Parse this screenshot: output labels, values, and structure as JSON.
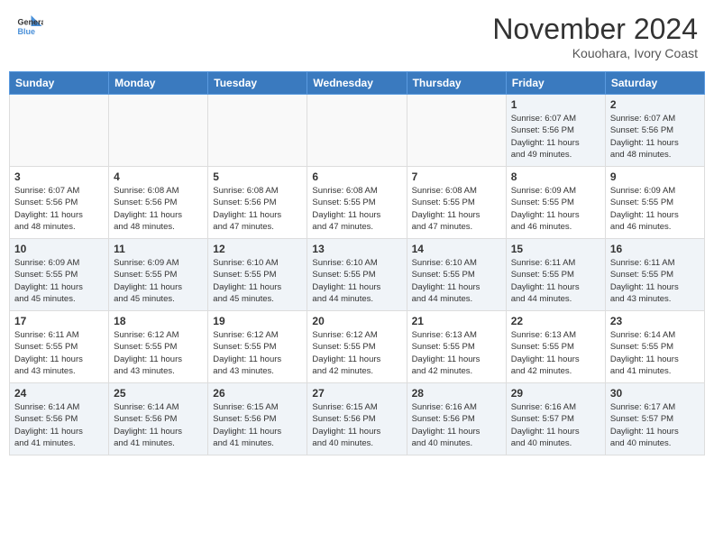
{
  "header": {
    "logo_general": "General",
    "logo_blue": "Blue",
    "month_title": "November 2024",
    "location": "Kouohara, Ivory Coast"
  },
  "weekdays": [
    "Sunday",
    "Monday",
    "Tuesday",
    "Wednesday",
    "Thursday",
    "Friday",
    "Saturday"
  ],
  "weeks": [
    [
      {
        "day": "",
        "info": "",
        "empty": true
      },
      {
        "day": "",
        "info": "",
        "empty": true
      },
      {
        "day": "",
        "info": "",
        "empty": true
      },
      {
        "day": "",
        "info": "",
        "empty": true
      },
      {
        "day": "",
        "info": "",
        "empty": true
      },
      {
        "day": "1",
        "info": "Sunrise: 6:07 AM\nSunset: 5:56 PM\nDaylight: 11 hours\nand 49 minutes."
      },
      {
        "day": "2",
        "info": "Sunrise: 6:07 AM\nSunset: 5:56 PM\nDaylight: 11 hours\nand 48 minutes."
      }
    ],
    [
      {
        "day": "3",
        "info": "Sunrise: 6:07 AM\nSunset: 5:56 PM\nDaylight: 11 hours\nand 48 minutes."
      },
      {
        "day": "4",
        "info": "Sunrise: 6:08 AM\nSunset: 5:56 PM\nDaylight: 11 hours\nand 48 minutes."
      },
      {
        "day": "5",
        "info": "Sunrise: 6:08 AM\nSunset: 5:56 PM\nDaylight: 11 hours\nand 47 minutes."
      },
      {
        "day": "6",
        "info": "Sunrise: 6:08 AM\nSunset: 5:55 PM\nDaylight: 11 hours\nand 47 minutes."
      },
      {
        "day": "7",
        "info": "Sunrise: 6:08 AM\nSunset: 5:55 PM\nDaylight: 11 hours\nand 47 minutes."
      },
      {
        "day": "8",
        "info": "Sunrise: 6:09 AM\nSunset: 5:55 PM\nDaylight: 11 hours\nand 46 minutes."
      },
      {
        "day": "9",
        "info": "Sunrise: 6:09 AM\nSunset: 5:55 PM\nDaylight: 11 hours\nand 46 minutes."
      }
    ],
    [
      {
        "day": "10",
        "info": "Sunrise: 6:09 AM\nSunset: 5:55 PM\nDaylight: 11 hours\nand 45 minutes."
      },
      {
        "day": "11",
        "info": "Sunrise: 6:09 AM\nSunset: 5:55 PM\nDaylight: 11 hours\nand 45 minutes."
      },
      {
        "day": "12",
        "info": "Sunrise: 6:10 AM\nSunset: 5:55 PM\nDaylight: 11 hours\nand 45 minutes."
      },
      {
        "day": "13",
        "info": "Sunrise: 6:10 AM\nSunset: 5:55 PM\nDaylight: 11 hours\nand 44 minutes."
      },
      {
        "day": "14",
        "info": "Sunrise: 6:10 AM\nSunset: 5:55 PM\nDaylight: 11 hours\nand 44 minutes."
      },
      {
        "day": "15",
        "info": "Sunrise: 6:11 AM\nSunset: 5:55 PM\nDaylight: 11 hours\nand 44 minutes."
      },
      {
        "day": "16",
        "info": "Sunrise: 6:11 AM\nSunset: 5:55 PM\nDaylight: 11 hours\nand 43 minutes."
      }
    ],
    [
      {
        "day": "17",
        "info": "Sunrise: 6:11 AM\nSunset: 5:55 PM\nDaylight: 11 hours\nand 43 minutes."
      },
      {
        "day": "18",
        "info": "Sunrise: 6:12 AM\nSunset: 5:55 PM\nDaylight: 11 hours\nand 43 minutes."
      },
      {
        "day": "19",
        "info": "Sunrise: 6:12 AM\nSunset: 5:55 PM\nDaylight: 11 hours\nand 43 minutes."
      },
      {
        "day": "20",
        "info": "Sunrise: 6:12 AM\nSunset: 5:55 PM\nDaylight: 11 hours\nand 42 minutes."
      },
      {
        "day": "21",
        "info": "Sunrise: 6:13 AM\nSunset: 5:55 PM\nDaylight: 11 hours\nand 42 minutes."
      },
      {
        "day": "22",
        "info": "Sunrise: 6:13 AM\nSunset: 5:55 PM\nDaylight: 11 hours\nand 42 minutes."
      },
      {
        "day": "23",
        "info": "Sunrise: 6:14 AM\nSunset: 5:55 PM\nDaylight: 11 hours\nand 41 minutes."
      }
    ],
    [
      {
        "day": "24",
        "info": "Sunrise: 6:14 AM\nSunset: 5:56 PM\nDaylight: 11 hours\nand 41 minutes."
      },
      {
        "day": "25",
        "info": "Sunrise: 6:14 AM\nSunset: 5:56 PM\nDaylight: 11 hours\nand 41 minutes."
      },
      {
        "day": "26",
        "info": "Sunrise: 6:15 AM\nSunset: 5:56 PM\nDaylight: 11 hours\nand 41 minutes."
      },
      {
        "day": "27",
        "info": "Sunrise: 6:15 AM\nSunset: 5:56 PM\nDaylight: 11 hours\nand 40 minutes."
      },
      {
        "day": "28",
        "info": "Sunrise: 6:16 AM\nSunset: 5:56 PM\nDaylight: 11 hours\nand 40 minutes."
      },
      {
        "day": "29",
        "info": "Sunrise: 6:16 AM\nSunset: 5:57 PM\nDaylight: 11 hours\nand 40 minutes."
      },
      {
        "day": "30",
        "info": "Sunrise: 6:17 AM\nSunset: 5:57 PM\nDaylight: 11 hours\nand 40 minutes."
      }
    ]
  ]
}
